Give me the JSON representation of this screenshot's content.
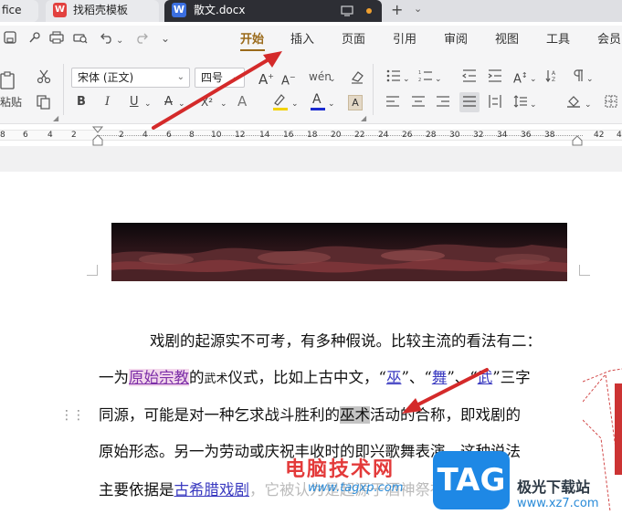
{
  "tabs": {
    "office": "fice",
    "template": "找稻壳模板",
    "document": "散文.docx",
    "template_icon": "wps-red-icon",
    "document_icon": "W"
  },
  "quick_access": [
    "save-icon",
    "brush-icon",
    "print-icon",
    "print-preview-icon",
    "undo-icon",
    "redo-icon",
    "dropdown-icon"
  ],
  "menu": {
    "items": [
      "开始",
      "插入",
      "页面",
      "引用",
      "审阅",
      "视图",
      "工具",
      "会员"
    ],
    "active": "开始"
  },
  "ribbon": {
    "font_name": "宋体 (正文)",
    "font_size": "四号",
    "paste_label": "粘贴",
    "bold": "B",
    "italic": "I",
    "underline": "U",
    "superscript": "X²",
    "border_char_label": "A"
  },
  "ruler": {
    "left_numbers": [
      "8",
      "6",
      "4",
      "2"
    ],
    "right_numbers": [
      "2",
      "4",
      "6",
      "8",
      "10",
      "12",
      "14",
      "16",
      "18",
      "20",
      "22",
      "24",
      "26",
      "28",
      "30",
      "32",
      "34",
      "36",
      "38",
      "40",
      "42"
    ],
    "end_number": "4"
  },
  "document": {
    "line1": "戏剧的起源实不可考，有多种假说。比较主流的看法有二：",
    "line2": {
      "a": "一为",
      "b": "原始宗教",
      "c": "的",
      "d": "武术",
      "e": "仪式，比如上古中文，“",
      "f": "巫",
      "g": "”、“",
      "h": "舞",
      "i": "”、“",
      "j": "武",
      "k": "”三字"
    },
    "line3": {
      "a": "同源，可能是对一种乞求战斗胜利的",
      "b": "巫术",
      "c": "活动的合称，即戏剧的"
    },
    "line4": "原始形态。另一为劳动或庆祝丰收时的即兴歌舞表演，这种说法",
    "line5": {
      "a": "主要依据是",
      "b": "古希腊戏剧",
      "c": "，它被认为是起源于酒神祭祀"
    }
  },
  "watermark": {
    "site_cn": "电脑技术网",
    "url": "www.tagxp.com",
    "logo": "TAG",
    "site2_cn": "极光下载站",
    "site2_url": "www.xz7.com"
  },
  "colors": {
    "accent": "#9a6a1a",
    "arrow": "#d42a2a",
    "link": "#3a3ac0",
    "highlight_pink": "#f3d7ec",
    "selection_gray": "#c4c4c4"
  }
}
